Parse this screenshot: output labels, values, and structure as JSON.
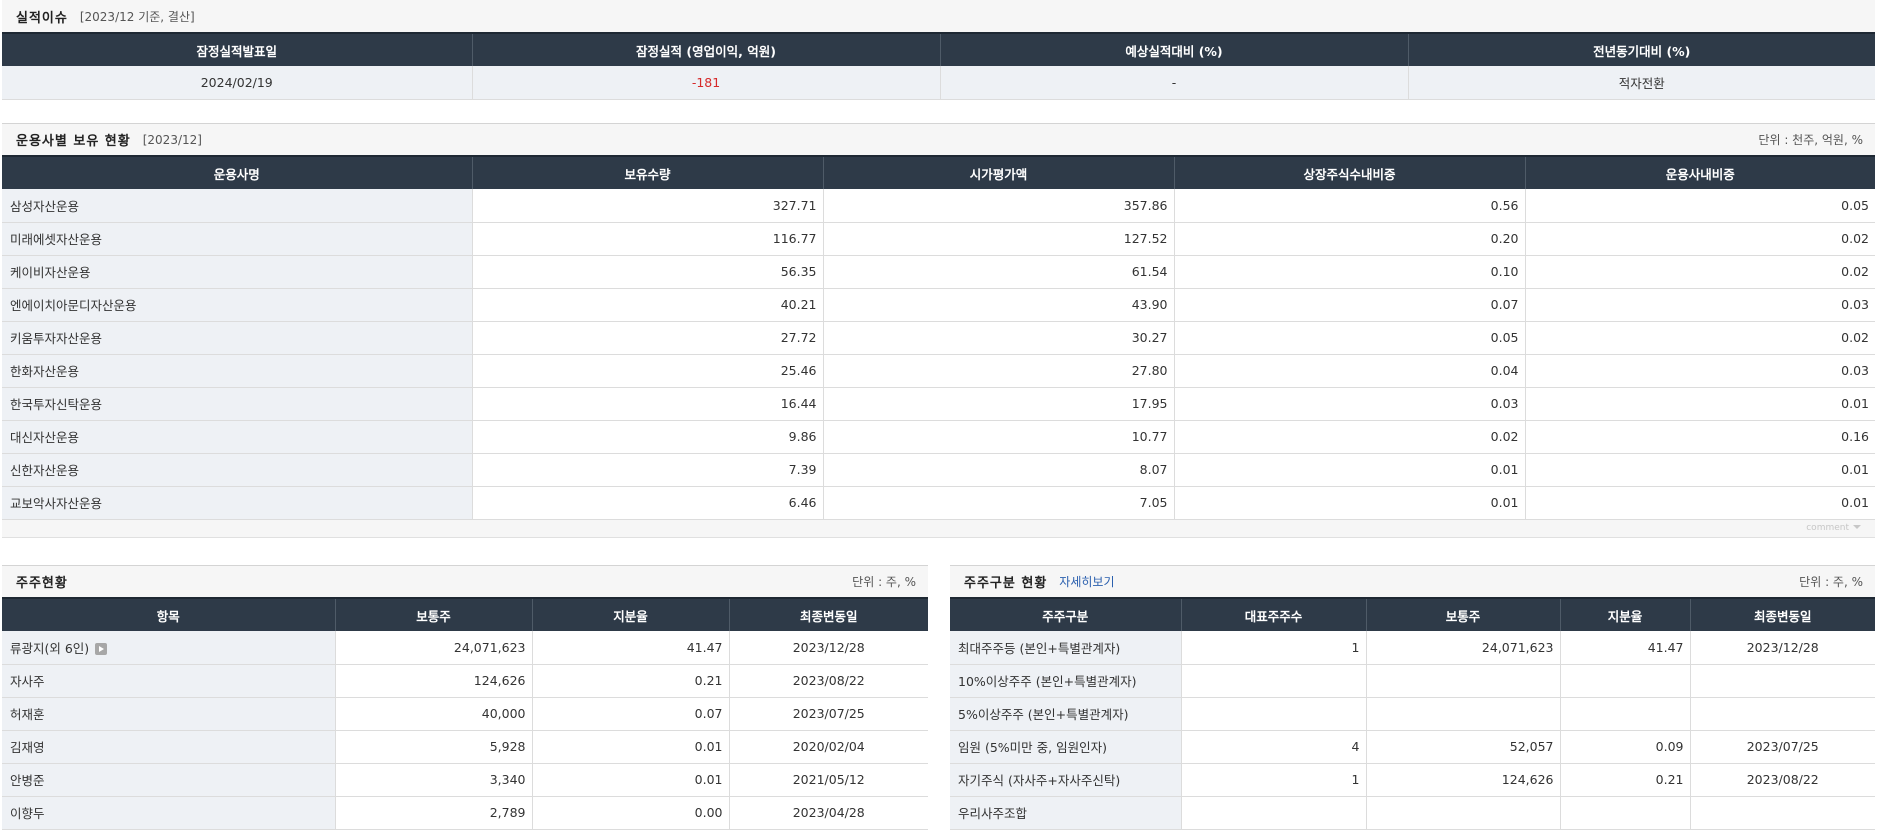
{
  "perf": {
    "title": "실적이슈",
    "subtitle": "[2023/12 기준, 결산]",
    "headers": [
      "잠정실적발표일",
      "잠정실적 (영업이익, 억원)",
      "예상실적대비 (%)",
      "전년동기대비 (%)"
    ],
    "row": [
      "2024/02/19",
      "-181",
      "-",
      "적자전환"
    ]
  },
  "managers": {
    "title": "운용사별 보유 현황",
    "subtitle": "[2023/12]",
    "unit": "단위 : 천주, 억원, %",
    "headers": [
      "운용사명",
      "보유수량",
      "시가평가액",
      "상장주식수내비중",
      "운용사내비중"
    ],
    "rows": [
      [
        "삼성자산운용",
        "327.71",
        "357.86",
        "0.56",
        "0.05"
      ],
      [
        "미래에셋자산운용",
        "116.77",
        "127.52",
        "0.20",
        "0.02"
      ],
      [
        "케이비자산운용",
        "56.35",
        "61.54",
        "0.10",
        "0.02"
      ],
      [
        "엔에이치아문디자산운용",
        "40.21",
        "43.90",
        "0.07",
        "0.03"
      ],
      [
        "키움투자자산운용",
        "27.72",
        "30.27",
        "0.05",
        "0.02"
      ],
      [
        "한화자산운용",
        "25.46",
        "27.80",
        "0.04",
        "0.03"
      ],
      [
        "한국투자신탁운용",
        "16.44",
        "17.95",
        "0.03",
        "0.01"
      ],
      [
        "대신자산운용",
        "9.86",
        "10.77",
        "0.02",
        "0.16"
      ],
      [
        "신한자산운용",
        "7.39",
        "8.07",
        "0.01",
        "0.01"
      ],
      [
        "교보악사자산운용",
        "6.46",
        "7.05",
        "0.01",
        "0.01"
      ]
    ],
    "comment": "comment"
  },
  "holders": {
    "title": "주주현황",
    "unit": "단위 : 주, %",
    "headers": [
      "항목",
      "보통주",
      "지분율",
      "최종변동일"
    ],
    "rows": [
      [
        "류광지(외 6인)",
        "24,071,623",
        "41.47",
        "2023/12/28"
      ],
      [
        "자사주",
        "124,626",
        "0.21",
        "2023/08/22"
      ],
      [
        "허재훈",
        "40,000",
        "0.07",
        "2023/07/25"
      ],
      [
        "김재영",
        "5,928",
        "0.01",
        "2020/02/04"
      ],
      [
        "안병준",
        "3,340",
        "0.01",
        "2021/05/12"
      ],
      [
        "이향두",
        "2,789",
        "0.00",
        "2023/04/28"
      ]
    ]
  },
  "classes": {
    "title": "주주구분 현황",
    "link": "자세히보기",
    "unit": "단위 : 주, %",
    "headers": [
      "주주구분",
      "대표주주수",
      "보통주",
      "지분율",
      "최종변동일"
    ],
    "rows": [
      [
        "최대주주등 (본인+특별관계자)",
        "1",
        "24,071,623",
        "41.47",
        "2023/12/28"
      ],
      [
        "10%이상주주 (본인+특별관계자)",
        "",
        "",
        "",
        ""
      ],
      [
        "5%이상주주 (본인+특별관계자)",
        "",
        "",
        "",
        ""
      ],
      [
        "임원 (5%미만 중, 임원인자)",
        "4",
        "52,057",
        "0.09",
        "2023/07/25"
      ],
      [
        "자기주식 (자사주+자사주신탁)",
        "1",
        "124,626",
        "0.21",
        "2023/08/22"
      ],
      [
        "우리사주조합",
        "",
        "",
        "",
        ""
      ]
    ]
  }
}
